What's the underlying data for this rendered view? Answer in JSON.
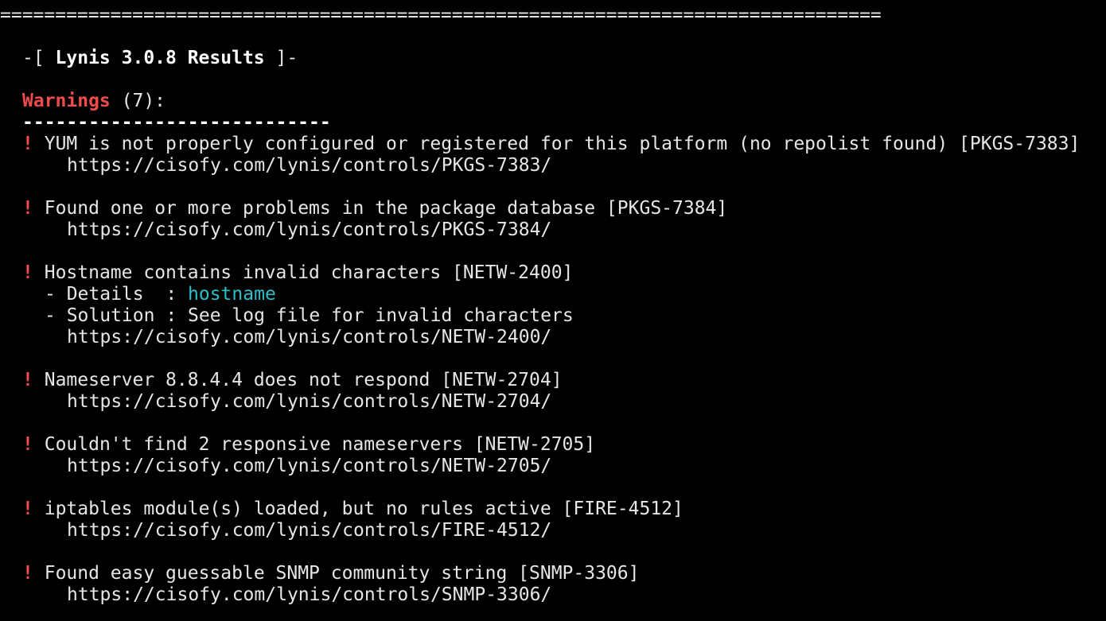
{
  "separator": "================================================================================",
  "header": {
    "prefix": "-[ ",
    "title": "Lynis 3.0.8 Results",
    "suffix": " ]-"
  },
  "warnings": {
    "label": "Warnings",
    "count_text": " (7):",
    "underline": "----------------------------",
    "marker": "!",
    "items": [
      {
        "text": "YUM is not properly configured or registered for this platform (no repolist found) [PKGS-7383]",
        "url": "https://cisofy.com/lynis/controls/PKGS-7383/"
      },
      {
        "text": "Found one or more problems in the package database [PKGS-7384]",
        "url": "https://cisofy.com/lynis/controls/PKGS-7384/"
      },
      {
        "text": "Hostname contains invalid characters [NETW-2400]",
        "details_label": "- Details  : ",
        "details_value": "hostname",
        "solution_label": "- Solution : ",
        "solution_value": "See log file for invalid characters",
        "url": "https://cisofy.com/lynis/controls/NETW-2400/"
      },
      {
        "text": "Nameserver 8.8.4.4 does not respond [NETW-2704]",
        "url": "https://cisofy.com/lynis/controls/NETW-2704/"
      },
      {
        "text": "Couldn't find 2 responsive nameservers [NETW-2705]",
        "url": "https://cisofy.com/lynis/controls/NETW-2705/"
      },
      {
        "text": "iptables module(s) loaded, but no rules active [FIRE-4512]",
        "url": "https://cisofy.com/lynis/controls/FIRE-4512/"
      },
      {
        "text": "Found easy guessable SNMP community string [SNMP-3306]",
        "url": "https://cisofy.com/lynis/controls/SNMP-3306/"
      }
    ]
  },
  "colors": {
    "background": "#000000",
    "text": "#e6e6e6",
    "warning_red": "#f24b4b",
    "detail_cyan": "#2bc0c8"
  }
}
